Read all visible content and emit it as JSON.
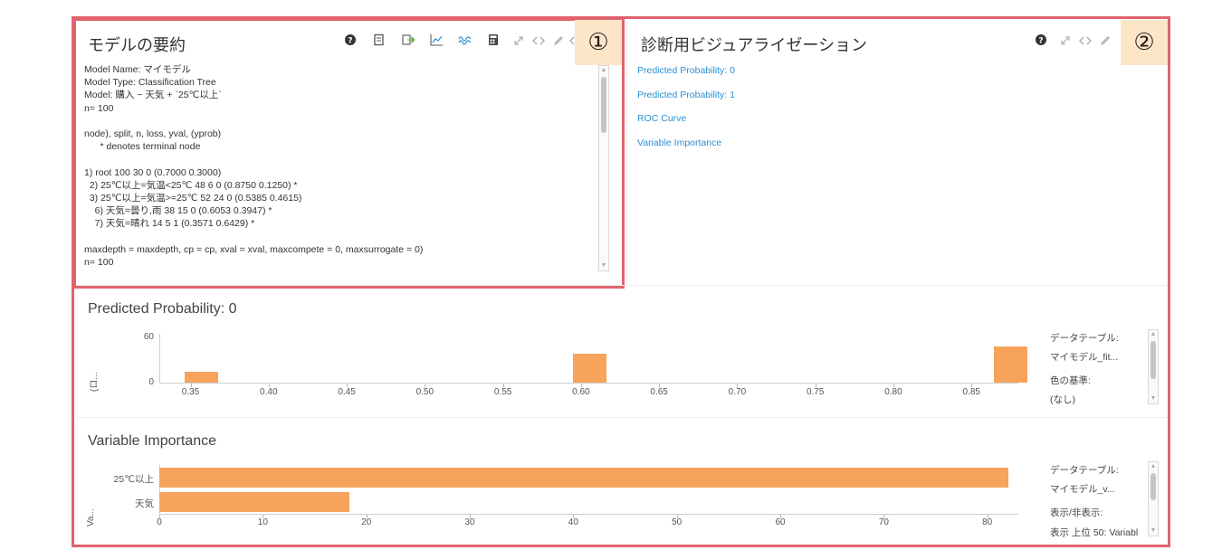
{
  "panel1": {
    "title": "モデルの要約",
    "badge": "①",
    "summary_lines": [
      "Model Name: マイモデル",
      "Model Type: Classification Tree",
      "Model: 購入 ~ 天気 + `25℃以上`",
      "n= 100",
      "",
      "node), split, n, loss, yval, (yprob)",
      "      * denotes terminal node",
      "",
      "1) root 100 30 0 (0.7000 0.3000)",
      "  2) 25℃以上=気温<25℃ 48 6 0 (0.8750 0.1250) *",
      "  3) 25℃以上=気温>=25℃ 52 24 0 (0.5385 0.4615)",
      "    6) 天気=曇り,雨 38 15 0 (0.6053 0.3947) *",
      "    7) 天気=晴れ 14 5 1 (0.3571 0.6429) *",
      "",
      "maxdepth = maxdepth, cp = cp, xval = xval, maxcompete = 0, maxsurrogate = 0)",
      "n= 100"
    ]
  },
  "panel2": {
    "title": "診断用ビジュアライゼーション",
    "badge": "②",
    "links": [
      "Predicted Probability: 0",
      "Predicted Probability: 1",
      "ROC Curve",
      "Variable Importance"
    ]
  },
  "chart1": {
    "title": "Predicted Probability: 0",
    "ylabel": "(ロ...",
    "side": {
      "label1": "データテーブル:",
      "value1": "マイモデル_fit...",
      "label2": "色の基準:",
      "value2": "(なし)"
    }
  },
  "chart2": {
    "title": "Variable Importance",
    "ylabel": "Va...",
    "side": {
      "label1": "データテーブル:",
      "value1": "マイモデル_v...",
      "label2": "表示/非表示:",
      "value2": "表示 上位 50: Variabl"
    }
  },
  "chart_data": [
    {
      "type": "bar",
      "title": "Predicted Probability: 0",
      "xlabel": "",
      "ylabel": "(ロ...",
      "x": [
        0.3571,
        0.6053,
        0.875
      ],
      "values": [
        14,
        38,
        48
      ],
      "x_ticks": [
        "0.35",
        "0.40",
        "0.45",
        "0.50",
        "0.55",
        "0.60",
        "0.65",
        "0.70",
        "0.75",
        "0.80",
        "0.85"
      ],
      "y_ticks": [
        "60",
        "0"
      ],
      "xlim": [
        0.33,
        0.88
      ],
      "ylim": [
        0,
        60
      ],
      "color": "#f7a35c",
      "grid": false
    },
    {
      "type": "bar",
      "orientation": "horizontal",
      "title": "Variable Importance",
      "xlabel": "",
      "ylabel": "Va...",
      "categories": [
        "25℃以上",
        "天気"
      ],
      "values": [
        82,
        18.4
      ],
      "x_ticks": [
        "0",
        "10",
        "20",
        "30",
        "40",
        "50",
        "60",
        "70",
        "80"
      ],
      "xlim": [
        0,
        83
      ],
      "color": "#f7a35c",
      "grid": false
    }
  ],
  "colors": {
    "accent": "#e0636d",
    "bar": "#f7a35c",
    "link": "#2a8fd6",
    "badge": "#fde6c7"
  },
  "icons": {
    "panel1": [
      "help-icon",
      "copy-icon",
      "export-icon",
      "line-chart-icon",
      "wave-chart-icon",
      "calculator-icon",
      "expand-icon",
      "code-icon",
      "edit-icon",
      "more-icon"
    ],
    "panel2": [
      "help-icon",
      "expand-icon",
      "code-icon",
      "edit-icon"
    ]
  }
}
